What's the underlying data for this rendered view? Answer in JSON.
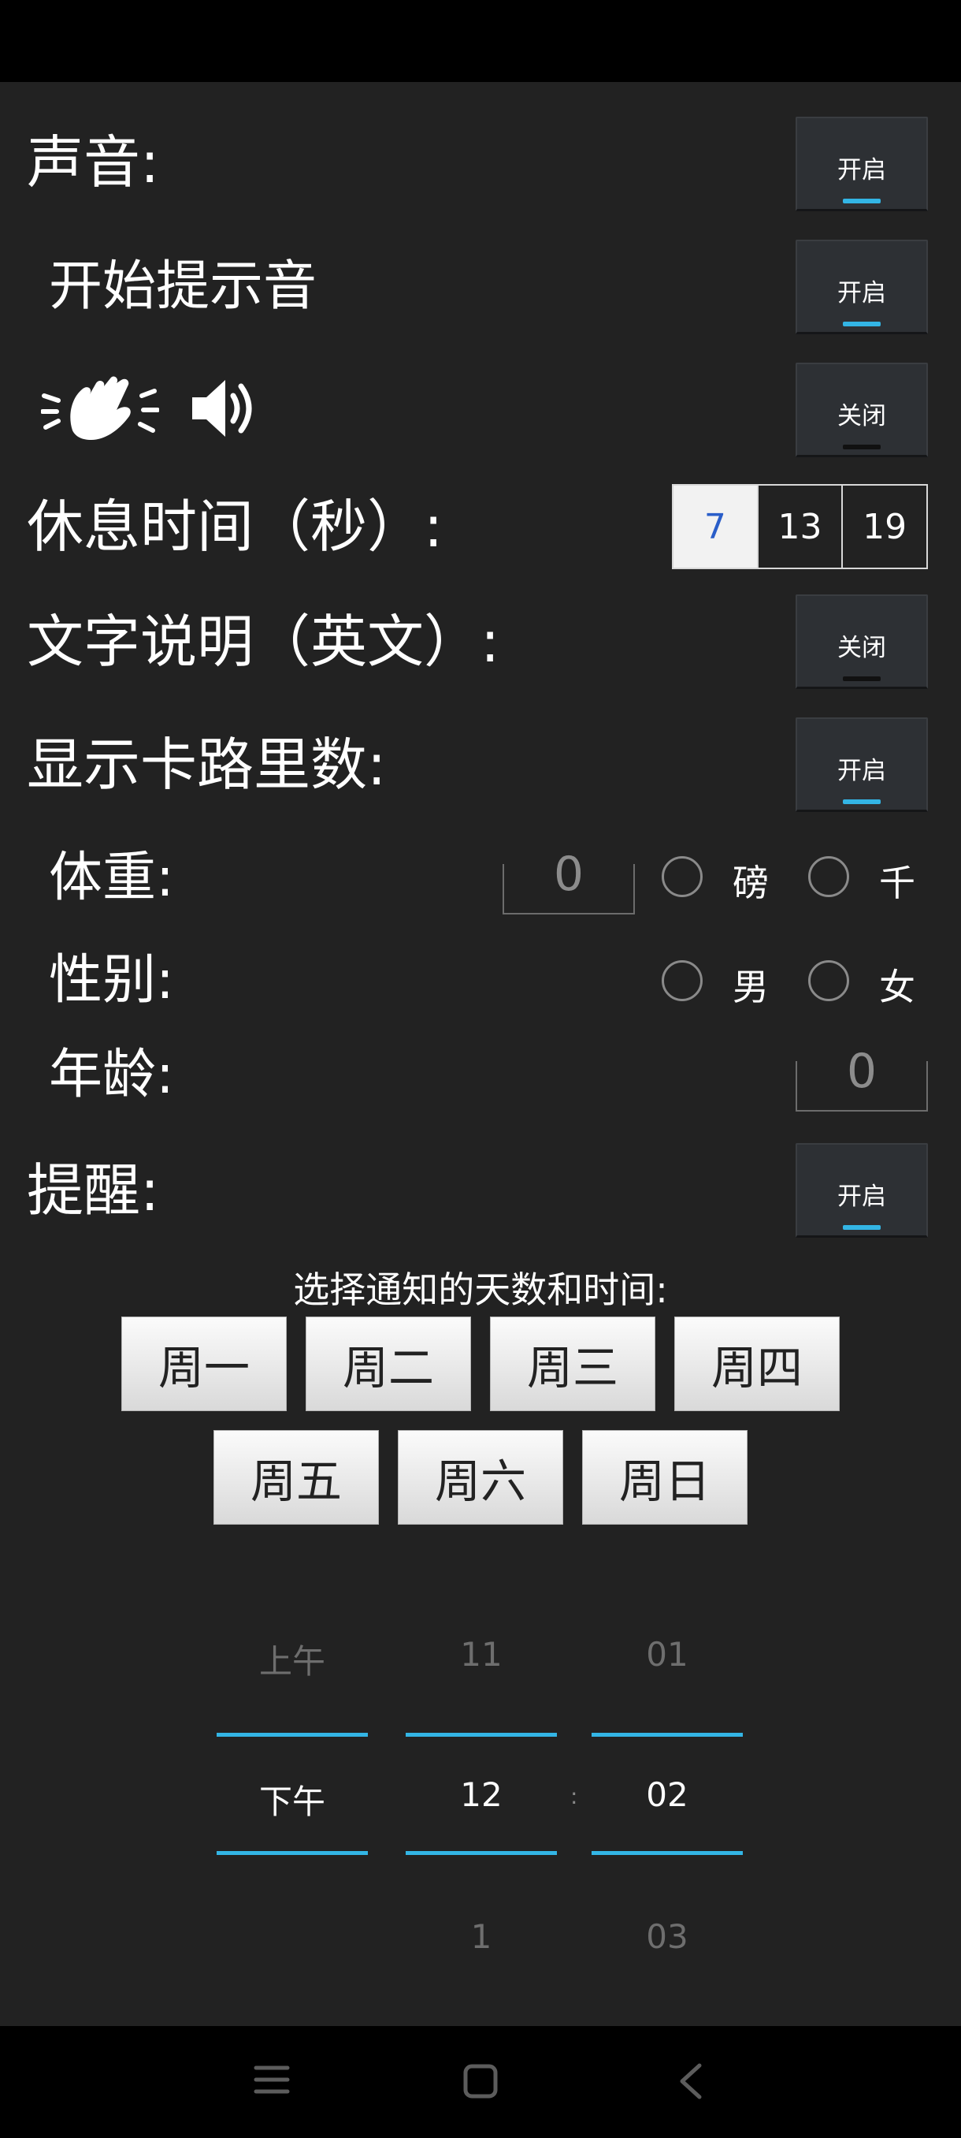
{
  "settings": {
    "sound": {
      "label": "声音:",
      "state": "开启",
      "on": true
    },
    "start_tone": {
      "label": "开始提示音",
      "state": "开启",
      "on": true
    },
    "clap_sound": {
      "state": "关闭",
      "on": false
    },
    "rest_time": {
      "label": "休息时间（秒）:",
      "options": [
        "7",
        "13",
        "19"
      ],
      "selected": "7"
    },
    "text_desc": {
      "label": "文字说明（英文）:",
      "state": "关闭",
      "on": false
    },
    "calories": {
      "label": "显示卡路里数:",
      "state": "开启",
      "on": true
    },
    "weight": {
      "label": "体重:",
      "value": "0",
      "unit_lb": "磅",
      "unit_kg": "千"
    },
    "gender": {
      "label": "性别:",
      "male": "男",
      "female": "女"
    },
    "age": {
      "label": "年龄:",
      "value": "0"
    },
    "reminder": {
      "label": "提醒:",
      "state": "开启",
      "on": true
    }
  },
  "notify": {
    "prompt": "选择通知的天数和时间:",
    "days": [
      "周一",
      "周二",
      "周三",
      "周四",
      "周五",
      "周六",
      "周日"
    ]
  },
  "time_picker": {
    "ampm": {
      "above": "上午",
      "selected": "下午"
    },
    "hour": {
      "above": "11",
      "selected": "12",
      "below": "1"
    },
    "minute": {
      "above": "01",
      "selected": "02",
      "below": "03"
    },
    "separator": ":"
  },
  "colors": {
    "accent": "#33b5e5",
    "selected_text": "#2a5ec9",
    "background": "#222222"
  }
}
